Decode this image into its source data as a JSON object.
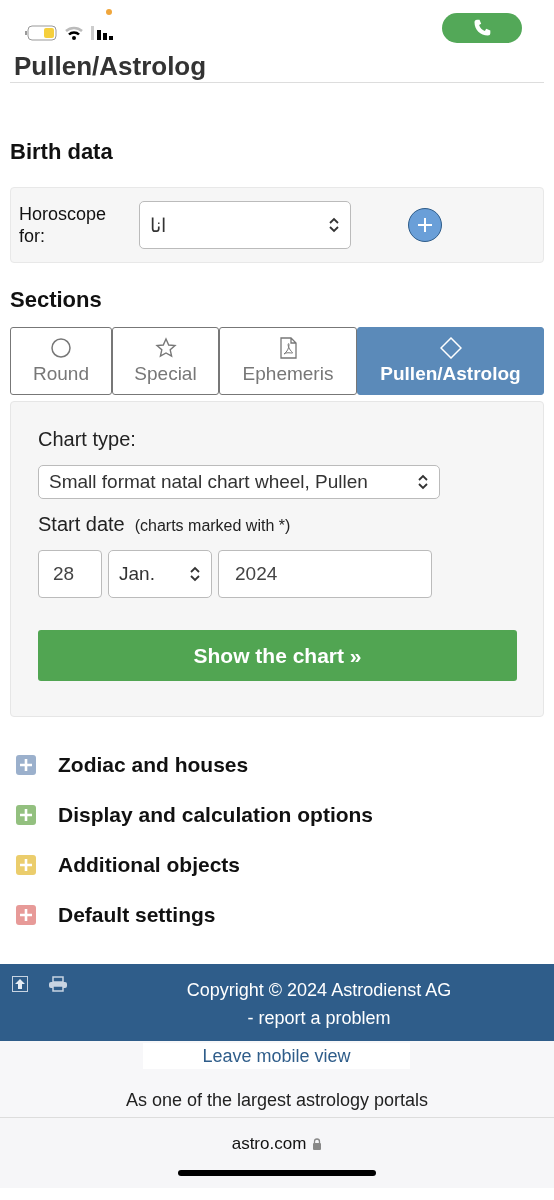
{
  "page_title": "Pullen/Astrolog",
  "birth_data": {
    "heading": "Birth data",
    "label": "Horoscope for:",
    "value": "انا"
  },
  "sections": {
    "heading": "Sections",
    "tabs": [
      {
        "label": "Round",
        "kind": "circle",
        "selected": false
      },
      {
        "label": "Special",
        "kind": "star",
        "selected": false
      },
      {
        "label": "Ephemeris",
        "kind": "pdf",
        "selected": false
      },
      {
        "label": "Pullen/Astrolog",
        "kind": "diamond",
        "selected": true
      }
    ]
  },
  "form": {
    "chart_type_label": "Chart type:",
    "chart_type": "Small format natal chart wheel, Pullen",
    "start_date_label": "Start date",
    "start_date_note": "(charts marked with *)",
    "day": "28",
    "month": "Jan.",
    "year": "2024",
    "submit": "Show the chart »"
  },
  "expanders": [
    {
      "label": "Zodiac and houses",
      "color": "#9bb0cc"
    },
    {
      "label": "Display and calculation options",
      "color": "#93c07f"
    },
    {
      "label": "Additional objects",
      "color": "#ebcd6c"
    },
    {
      "label": "Default settings",
      "color": "#e79a98"
    }
  ],
  "footer": {
    "copyright": "Copyright © 2024 Astrodienst AG",
    "report_link": "- report a problem",
    "leave_mobile": "Leave mobile view",
    "teaser": "As one of the largest astrology portals"
  },
  "browser": {
    "url": "astro.com"
  }
}
